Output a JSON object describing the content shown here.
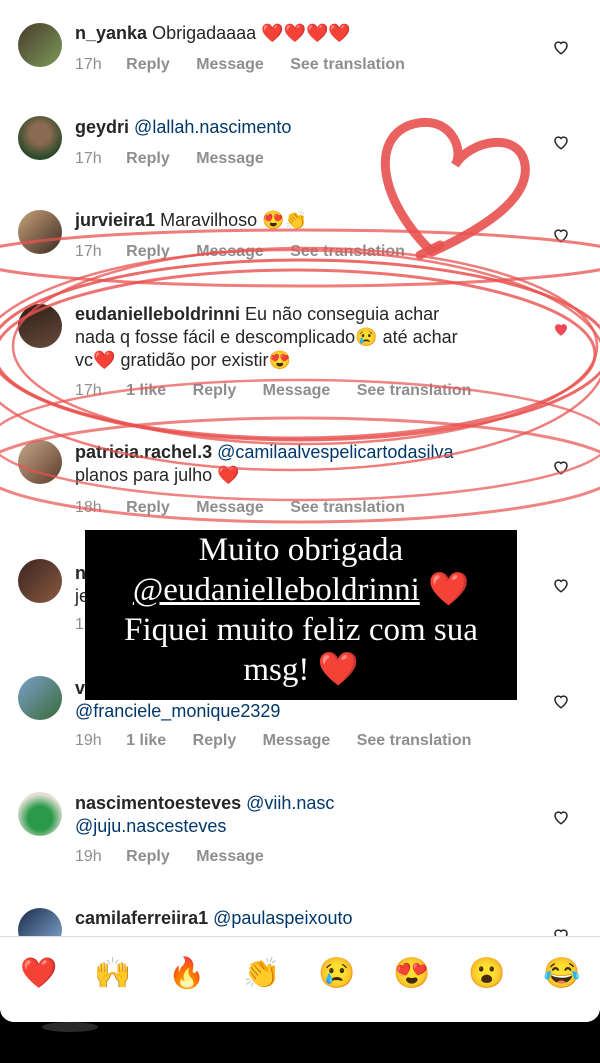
{
  "comments": [
    {
      "user": "n_yanka",
      "text": "Obrigadaaaa",
      "emoji": "❤️❤️❤️❤️",
      "time": "17h",
      "actions": [
        "Reply",
        "Message",
        "See translation"
      ],
      "likes": ""
    },
    {
      "user": "geydri",
      "mention": "@lallah.nascimento",
      "time": "17h",
      "actions": [
        "Reply",
        "Message"
      ],
      "likes": ""
    },
    {
      "user": "jurvieira1",
      "text": "Maravilhoso",
      "emoji": "😍👏",
      "time": "17h",
      "actions": [
        "Reply",
        "Message",
        "See translation"
      ],
      "likes": ""
    },
    {
      "user": "eudanielleboldrinni",
      "text1": "Eu não conseguia achar",
      "text2": "nada q fosse fácil e descomplicado",
      "emoji1": "😢",
      "text3": "até achar",
      "text4": "vc",
      "emoji2": "❤️",
      "text5": "gratidão por existir",
      "emoji3": "😍",
      "time": "17h",
      "likes": "1 like",
      "actions": [
        "Reply",
        "Message",
        "See translation"
      ]
    },
    {
      "user": "patricia.rachel.3",
      "mention": "@camilaalvespelicartodasilva",
      "text": "planos para julho",
      "emoji": "❤️",
      "time": "18h",
      "actions": [
        "Reply",
        "Message",
        "See translation"
      ],
      "likes": ""
    },
    {
      "user": "n",
      "text": "je",
      "time": "1",
      "actions": [],
      "likes": ""
    },
    {
      "user": "v",
      "mention": "@franciele_monique2329",
      "time": "19h",
      "likes": "1 like",
      "actions": [
        "Reply",
        "Message",
        "See translation"
      ]
    },
    {
      "user": "nascimentoesteves",
      "mention": "@viih.nasc",
      "mention2": "@juju.nascesteves",
      "time": "19h",
      "actions": [
        "Reply",
        "Message"
      ],
      "likes": ""
    },
    {
      "user": "camilaferreiira1",
      "mention": "@paulaspeixouto",
      "time": "",
      "actions": [],
      "likes": ""
    }
  ],
  "overlay": {
    "line1": "Muito obrigada",
    "line2": "@eudanielleboldrinni",
    "line3": "Fiquei muito feliz com sua",
    "line4": "msg!",
    "heart": "❤️"
  },
  "reactions": [
    "❤️",
    "🙌",
    "🔥",
    "👏",
    "😢",
    "😍",
    "😮",
    "😂"
  ],
  "colors": {
    "scribble": "#e8514f",
    "like_red": "#ed4956",
    "text": "#262626",
    "meta": "#8e8e8e",
    "mention": "#00376b"
  }
}
